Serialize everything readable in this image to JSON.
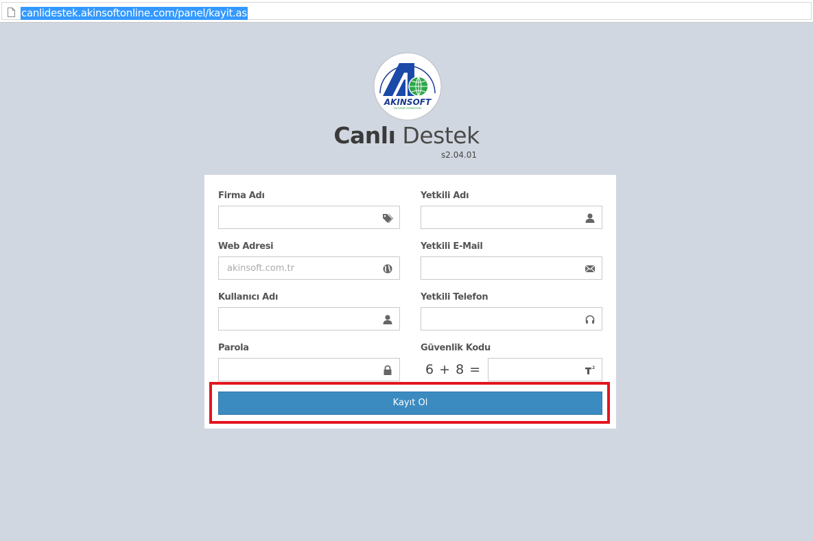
{
  "browser": {
    "url": "canlidestek.akinsoftonline.com/panel/kayit.as"
  },
  "header": {
    "title_bold": "Canlı",
    "title_light": "Destek",
    "version": "s2.04.01",
    "logo_text": "AKINSOFT",
    "logo_tagline": "SOFTWARE ENGINEERING"
  },
  "form": {
    "firma_label": "Firma Adı",
    "firma_value": "",
    "yetkili_label": "Yetkili Adı",
    "yetkili_value": "",
    "web_label": "Web Adresi",
    "web_placeholder": "akinsoft.com.tr",
    "email_label": "Yetkili E-Mail",
    "email_value": "",
    "kullanici_label": "Kullanıcı Adı",
    "kullanici_value": "",
    "telefon_label": "Yetkili Telefon",
    "telefon_value": "",
    "parola_label": "Parola",
    "parola_value": "",
    "guvenlik_label": "Güvenlik Kodu",
    "captcha_text": "6 + 8 =",
    "guvenlik_value": "",
    "submit_label": "Kayıt Ol"
  },
  "icons": {
    "firma": "tags-icon",
    "yetkili": "user-icon",
    "web": "globe-icon",
    "email": "envelope-icon",
    "kullanici": "user-icon",
    "telefon": "headphones-icon",
    "parola": "lock-icon",
    "guvenlik": "superscript-icon"
  },
  "colors": {
    "background": "#d1d7e0",
    "button": "#3b8bc1",
    "highlight": "#e3141f",
    "url_selection": "#3399ff"
  }
}
